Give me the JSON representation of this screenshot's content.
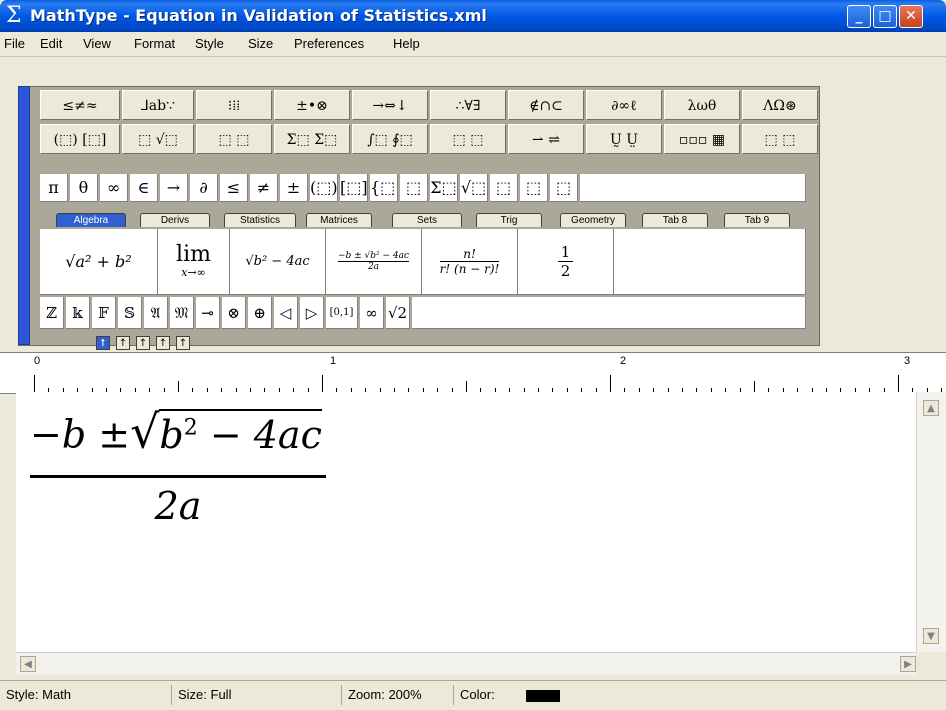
{
  "window": {
    "title": "MathType - Equation in Validation of Statistics.xml",
    "app_icon": "sigma-icon",
    "min_label": "_",
    "max_label": "□",
    "close_label": "✕"
  },
  "menu": [
    "File",
    "Edit",
    "View",
    "Format",
    "Style",
    "Size",
    "Preferences",
    "Help"
  ],
  "palette_row1": [
    "≤≠≈",
    "⅃ab∵",
    "⁝⁞⁞",
    "±•⊗",
    "→⇔↓",
    "∴∀∃",
    "∉∩⊂",
    "∂∞ℓ",
    "λωθ",
    "ΛΩ⊛"
  ],
  "palette_row2": [
    "(⬚) [⬚]",
    "⬚ √⬚",
    "⬚ ⬚",
    "Σ⬚ Σ⬚",
    "∫⬚ ∮⬚",
    "⬚ ⬚",
    "⇀ ⇌",
    "Ṵ Ṳ",
    "▫▫▫ ▦",
    "⬚ ⬚"
  ],
  "small_bar": [
    "π",
    "θ",
    "∞",
    "∈",
    "→",
    "∂",
    "≤",
    "≠",
    "±",
    "(⬚)",
    "[⬚]",
    "{⬚}",
    "⬚",
    "Σ⬚",
    "√⬚",
    "⬚",
    "⬚",
    "⬚"
  ],
  "tabs": [
    "Algebra",
    "Derivs",
    "Statistics",
    "Matrices",
    "Sets",
    "Trig",
    "Geometry",
    "Tab 8",
    "Tab 9"
  ],
  "active_tab": "Algebra",
  "templates": {
    "t1": "√a² + b²",
    "t2_top": "lim",
    "t2_bottom": "x→∞",
    "t3": "√b² − 4ac",
    "t4_num": "−b ± √b² − 4ac",
    "t4_den": "2a",
    "t5_num": "n!",
    "t5_den": "r! (n − r)!",
    "t6_num": "1",
    "t6_den": "2"
  },
  "symbols": [
    "ℤ",
    "𝕜",
    "𝔽",
    "𝕊",
    "𝔄",
    "𝔐",
    "⊸",
    "⊗",
    "⊕",
    "◁",
    "▷",
    "[0,1]",
    "∞",
    "√2"
  ],
  "tabstops": [
    "⭡",
    "↑",
    "↑",
    "↑",
    "↑"
  ],
  "ruler_labels": [
    "0",
    "1",
    "2",
    "3"
  ],
  "equation": {
    "numerator_prefix": "−b ±",
    "radicand": "b",
    "exponent": "2",
    "radicand_tail": " − 4ac",
    "denominator": "2a"
  },
  "status": {
    "style": "Style: Math",
    "size": "Size: Full",
    "zoom": "Zoom: 200%",
    "color_label": "Color:",
    "color_value": "#000000"
  }
}
